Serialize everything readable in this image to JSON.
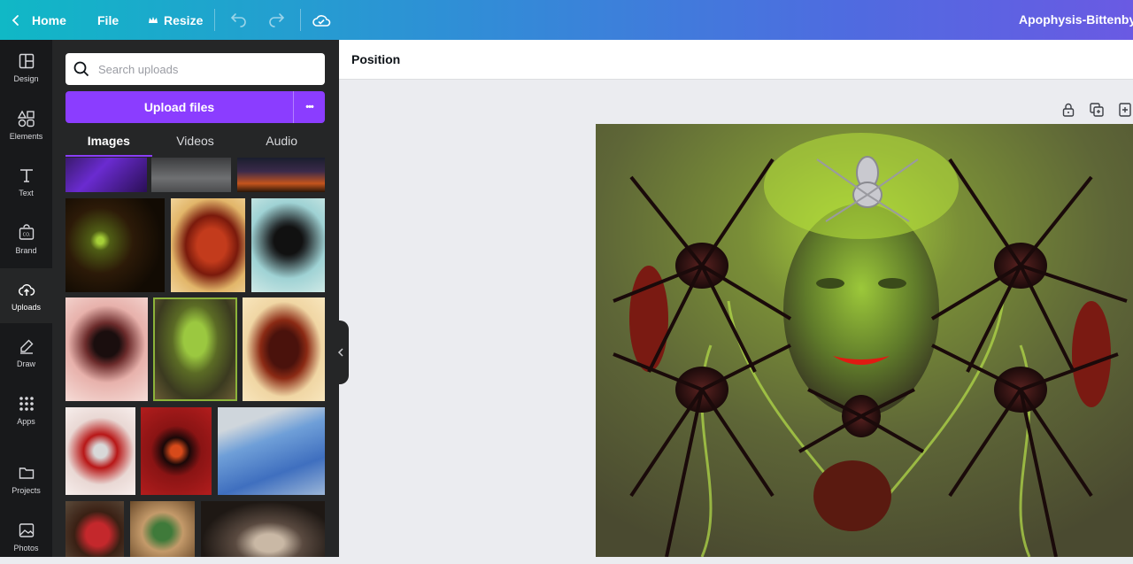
{
  "topbar": {
    "home_label": "Home",
    "file_label": "File",
    "resize_label": "Resize",
    "document_title": "Apophysis-BittenbyS"
  },
  "rail": {
    "items": [
      {
        "label": "Design",
        "icon": "layout-icon"
      },
      {
        "label": "Elements",
        "icon": "shapes-icon"
      },
      {
        "label": "Text",
        "icon": "text-icon"
      },
      {
        "label": "Brand",
        "icon": "brand-kit-icon"
      },
      {
        "label": "Uploads",
        "icon": "cloud-upload-icon",
        "active": true
      },
      {
        "label": "Draw",
        "icon": "pen-icon"
      },
      {
        "label": "Apps",
        "icon": "grid-icon"
      },
      {
        "label": "Projects",
        "icon": "folder-icon"
      },
      {
        "label": "Photos",
        "icon": "image-icon"
      }
    ]
  },
  "panel": {
    "search_placeholder": "Search uploads",
    "upload_label": "Upload files",
    "more_label": "•••",
    "tabs": [
      {
        "label": "Images",
        "active": true
      },
      {
        "label": "Videos"
      },
      {
        "label": "Audio"
      }
    ]
  },
  "uploads": [
    {
      "name": "purple fractal"
    },
    {
      "name": "grey mist"
    },
    {
      "name": "fire landscape"
    },
    {
      "name": "green fractal swirl"
    },
    {
      "name": "red snake"
    },
    {
      "name": "black spider on teal"
    },
    {
      "name": "spider on pink"
    },
    {
      "name": "green spider queen"
    },
    {
      "name": "red scorpion"
    },
    {
      "name": "white spider on red"
    },
    {
      "name": "red black spider"
    },
    {
      "name": "surgery photo"
    },
    {
      "name": "red painted face"
    },
    {
      "name": "green woman"
    },
    {
      "name": "cave"
    }
  ],
  "editor": {
    "position_label": "Position"
  },
  "colors": {
    "accent": "#8b3dff",
    "rail_bg": "#18191b",
    "panel_bg": "#252627",
    "canvas_bg": "#ebecf0"
  }
}
